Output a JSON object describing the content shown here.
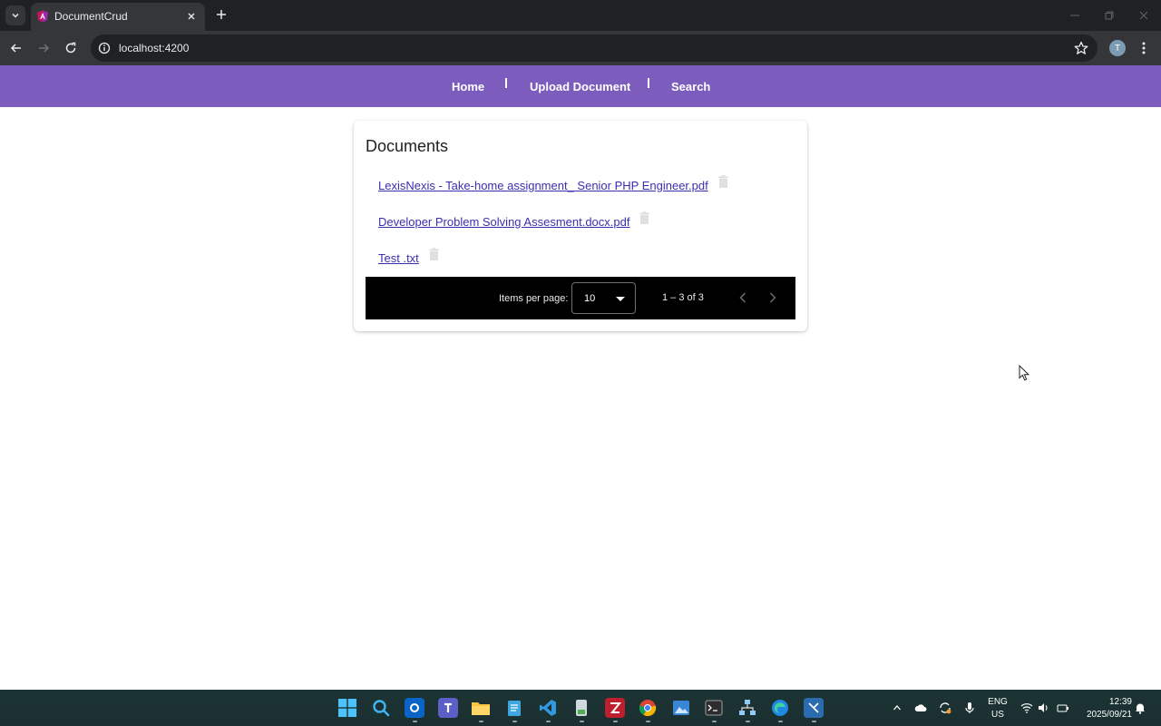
{
  "browser": {
    "tab_title": "DocumentCrud",
    "url": "localhost:4200",
    "profile_initial": "T"
  },
  "nav": {
    "items": [
      {
        "label": "Home"
      },
      {
        "label": "Upload Document"
      },
      {
        "label": "Search"
      }
    ]
  },
  "documents": {
    "title": "Documents",
    "items": [
      {
        "name": "LexisNexis - Take-home assignment_ Senior PHP Engineer.pdf"
      },
      {
        "name": "Developer Problem Solving Assesment.docx.pdf"
      },
      {
        "name": "Test .txt"
      }
    ]
  },
  "paginator": {
    "items_per_page_label": "Items per page:",
    "items_per_page_value": "10",
    "range_label": "1 – 3 of 3"
  },
  "taskbar": {
    "lang_line1": "ENG",
    "lang_line2": "US",
    "time": "12:39",
    "date": "2025/09/21"
  },
  "colors": {
    "nav_bar": "#7c5cbd",
    "link": "#3a2fb0",
    "paginator_bg": "#000000"
  }
}
